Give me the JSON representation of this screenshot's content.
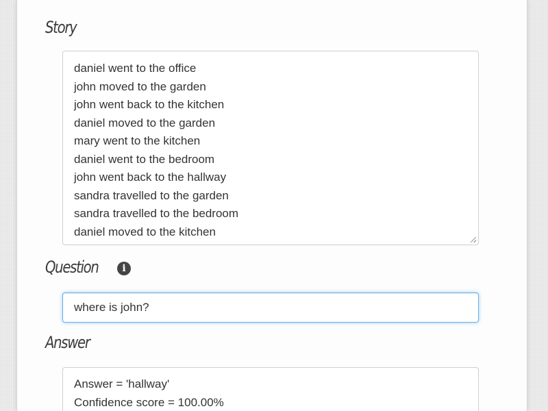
{
  "story": {
    "label": "Story",
    "lines": [
      "daniel went to the office",
      "john moved to the garden",
      "john went back to the kitchen",
      "daniel moved to the garden",
      "mary went to the kitchen",
      "daniel went to the bedroom",
      "john went back to the hallway",
      "sandra travelled to the garden",
      "sandra travelled to the bedroom",
      "daniel moved to the kitchen"
    ]
  },
  "question": {
    "label": "Question",
    "info_icon": "info-icon",
    "value": "where is john?"
  },
  "answer": {
    "label": "Answer",
    "lines": [
      "Answer = 'hallway'",
      "Confidence score = 100.00%"
    ]
  },
  "colors": {
    "focus_border": "#66afe9",
    "label_text": "#3a3a3a",
    "body_text": "#333333"
  }
}
